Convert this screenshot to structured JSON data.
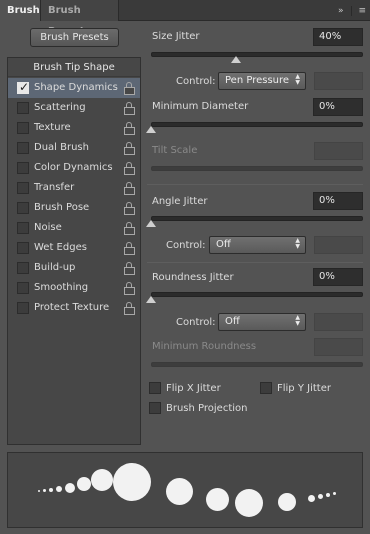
{
  "tabs": [
    {
      "label": "Brush"
    },
    {
      "label": "Brush Presets"
    }
  ],
  "tab_icons": {
    "collapse": "»",
    "menu": "≡"
  },
  "left": {
    "presets_button": "Brush Presets",
    "tip_shape": "Brush Tip Shape",
    "items": [
      {
        "label": "Shape Dynamics",
        "checked": true,
        "selected": true
      },
      {
        "label": "Scattering",
        "checked": false
      },
      {
        "label": "Texture",
        "checked": false
      },
      {
        "label": "Dual Brush",
        "checked": false
      },
      {
        "label": "Color Dynamics",
        "checked": false
      },
      {
        "label": "Transfer",
        "checked": false
      },
      {
        "label": "Brush Pose",
        "checked": false
      },
      {
        "label": "Noise",
        "checked": false
      },
      {
        "label": "Wet Edges",
        "checked": false
      },
      {
        "label": "Build-up",
        "checked": false
      },
      {
        "label": "Smoothing",
        "checked": false
      },
      {
        "label": "Protect Texture",
        "checked": false
      }
    ]
  },
  "right": {
    "size_jitter": {
      "label": "Size Jitter",
      "value": "40%",
      "slider": 0.4
    },
    "size_control": {
      "label": "Control:",
      "value": "Pen Pressure"
    },
    "min_diameter": {
      "label": "Minimum Diameter",
      "value": "0%",
      "slider": 0.0
    },
    "tilt_scale": {
      "label": "Tilt Scale"
    },
    "angle_jitter": {
      "label": "Angle Jitter",
      "value": "0%",
      "slider": 0.0
    },
    "angle_control": {
      "label": "Control:",
      "value": "Off"
    },
    "roundness_jitter": {
      "label": "Roundness Jitter",
      "value": "0%",
      "slider": 0.0
    },
    "roundness_control": {
      "label": "Control:",
      "value": "Off"
    },
    "min_roundness": {
      "label": "Minimum Roundness"
    },
    "flip_x": {
      "label": "Flip X Jitter",
      "checked": false
    },
    "flip_y": {
      "label": "Flip Y Jitter",
      "checked": false
    },
    "brush_projection": {
      "label": "Brush Projection",
      "checked": false
    }
  },
  "colors": {
    "panel": "#535353",
    "selected_row": "#5d6775",
    "field": "#2e2e2e"
  }
}
